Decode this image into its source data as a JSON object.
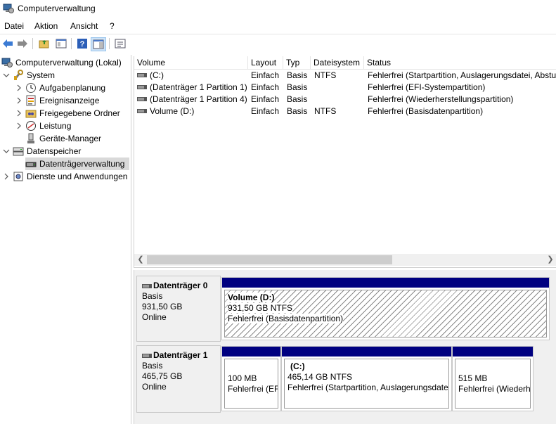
{
  "window": {
    "title": "Computerverwaltung"
  },
  "menu": [
    "Datei",
    "Aktion",
    "Ansicht",
    "?"
  ],
  "tree": {
    "root": "Computerverwaltung (Lokal)",
    "system": "System",
    "system_items": [
      "Aufgabenplanung",
      "Ereignisanzeige",
      "Freigegebene Ordner",
      "Leistung",
      "Geräte-Manager"
    ],
    "storage": "Datenspeicher",
    "storage_items": [
      "Datenträgerverwaltung"
    ],
    "services": "Dienste und Anwendungen"
  },
  "volume_list": {
    "columns": [
      "Volume",
      "Layout",
      "Typ",
      "Dateisystem",
      "Status"
    ],
    "rows": [
      [
        "(C:)",
        "Einfach",
        "Basis",
        "NTFS",
        "Fehlerfrei (Startpartition, Auslagerungsdatei, Abstu"
      ],
      [
        "(Datenträger 1 Partition 1)",
        "Einfach",
        "Basis",
        "",
        "Fehlerfrei (EFI-Systempartition)"
      ],
      [
        "(Datenträger 1 Partition 4)",
        "Einfach",
        "Basis",
        "",
        "Fehlerfrei (Wiederherstellungspartition)"
      ],
      [
        "Volume (D:)",
        "Einfach",
        "Basis",
        "NTFS",
        "Fehlerfrei (Basisdatenpartition)"
      ]
    ]
  },
  "disks": [
    {
      "name": "Datenträger 0",
      "type": "Basis",
      "size": "931,50 GB",
      "status": "Online",
      "partitions": [
        {
          "title": "Volume  (D:)",
          "size": "931,50 GB NTFS",
          "status": "Fehlerfrei (Basisdatenpartition)"
        }
      ]
    },
    {
      "name": "Datenträger 1",
      "type": "Basis",
      "size": "465,75 GB",
      "status": "Online",
      "partitions": [
        {
          "title": "",
          "size": "100 MB",
          "status": "Fehlerfrei (EF"
        },
        {
          "title": "(C:)",
          "size": "465,14 GB NTFS",
          "status": "Fehlerfrei (Startpartition, Auslagerungsdate"
        },
        {
          "title": "",
          "size": "515 MB",
          "status": "Fehlerfrei (Wiederh"
        }
      ]
    }
  ],
  "colors": {
    "partition_bar": "#000080",
    "selected": "#d9d9d9"
  }
}
